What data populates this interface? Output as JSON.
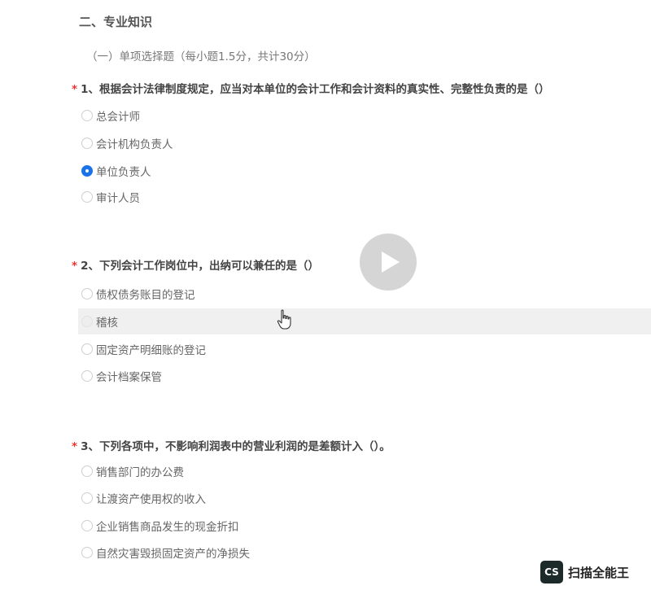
{
  "section": {
    "title": "二、专业知识",
    "subtitle": "（一）单项选择题（每小题1.5分，共计30分）"
  },
  "questions": [
    {
      "required_mark": "*",
      "title": "1、根据会计法律制度规定，应当对本单位的会计工作和会计资料的真实性、完整性负责的是（）",
      "options": [
        {
          "label": "总会计师",
          "checked": false
        },
        {
          "label": "会计机构负责人",
          "checked": false
        },
        {
          "label": "单位负责人",
          "checked": true
        },
        {
          "label": "审计人员",
          "checked": false
        }
      ]
    },
    {
      "required_mark": "*",
      "title": "2、下列会计工作岗位中，出纳可以兼任的是（）",
      "options": [
        {
          "label": "债权债务账目的登记",
          "checked": false
        },
        {
          "label": "稽核",
          "checked": false
        },
        {
          "label": "固定资产明细账的登记",
          "checked": false
        },
        {
          "label": "会计档案保管",
          "checked": false
        }
      ]
    },
    {
      "required_mark": "*",
      "title": "3、下列各项中，不影响利润表中的营业利润的是差额计入（）。",
      "options": [
        {
          "label": "销售部门的办公费",
          "checked": false
        },
        {
          "label": "让渡资产使用权的收入",
          "checked": false
        },
        {
          "label": "企业销售商品发生的现金折扣",
          "checked": false
        },
        {
          "label": "自然灾害毁损固定资产的净损失",
          "checked": false
        }
      ]
    }
  ],
  "overlay": {
    "play_icon": "play-icon",
    "cursor_icon": "hand-pointer-icon"
  },
  "watermark": {
    "logo_text": "CS",
    "text": "扫描全能王"
  },
  "colors": {
    "accent": "#1a73e8",
    "required": "#e33333",
    "hover_row": "#f0f0f0"
  }
}
